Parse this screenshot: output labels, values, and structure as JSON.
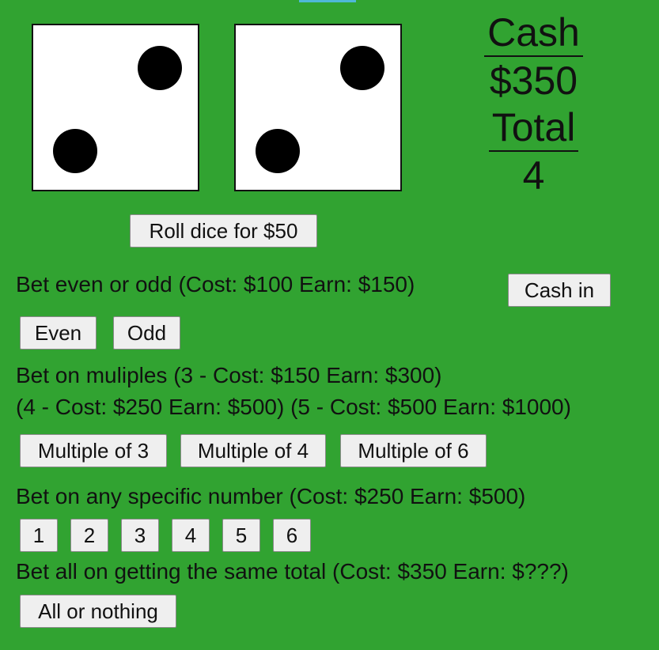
{
  "dice": [
    {
      "value": 2
    },
    {
      "value": 2
    }
  ],
  "stats": {
    "cash_label": "Cash",
    "cash_value": "$350",
    "total_label": "Total",
    "total_value": "4"
  },
  "roll_button": "Roll dice for $50",
  "even_odd": {
    "heading": "Bet even or odd (Cost: $100 Earn: $150)",
    "cash_in": "Cash in",
    "even": "Even",
    "odd": "Odd"
  },
  "multiples": {
    "heading_line1": "Bet on muliples (3 - Cost: $150 Earn: $300)",
    "heading_line2": "(4 - Cost: $250 Earn: $500) (5 - Cost: $500 Earn: $1000)",
    "buttons": [
      "Multiple of 3",
      "Multiple of 4",
      "Multiple of 6"
    ]
  },
  "specific": {
    "heading": "Bet on any specific number (Cost: $250 Earn: $500)",
    "numbers": [
      "1",
      "2",
      "3",
      "4",
      "5",
      "6"
    ]
  },
  "all_or_nothing": {
    "heading": "Bet all on getting the same total (Cost: $350 Earn: $???)",
    "button": "All or nothing"
  }
}
